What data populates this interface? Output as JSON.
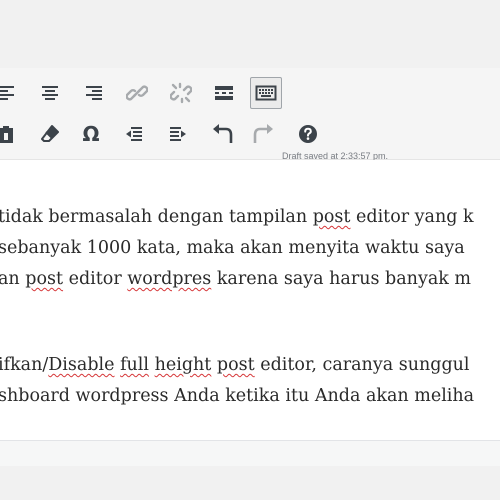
{
  "toolbar": {
    "row1": [
      {
        "name": "align-left-icon"
      },
      {
        "name": "align-center-icon"
      },
      {
        "name": "align-right-icon"
      },
      {
        "name": "insert-link-icon"
      },
      {
        "name": "remove-link-icon"
      },
      {
        "name": "read-more-icon"
      },
      {
        "name": "toolbar-toggle-icon",
        "active": true
      }
    ],
    "row2": [
      {
        "name": "paste-as-text-icon"
      },
      {
        "name": "clear-formatting-icon"
      },
      {
        "name": "special-character-icon",
        "glyph": "Ω"
      },
      {
        "name": "decrease-indent-icon"
      },
      {
        "name": "increase-indent-icon"
      },
      {
        "name": "undo-icon"
      },
      {
        "name": "redo-icon"
      },
      {
        "name": "keyboard-shortcuts-icon"
      }
    ]
  },
  "status": {
    "text": "Draft saved at 2:33:57 pm."
  },
  "content": {
    "lines": [
      [
        {
          "t": "tidak bermasalah dengan tampilan "
        },
        {
          "t": "post",
          "sp": true
        },
        {
          "t": " editor yang k"
        }
      ],
      [
        {
          "t": "sebanyak 1000 kata, maka akan menyita waktu saya"
        }
      ],
      [
        {
          "t": "an "
        },
        {
          "t": "post",
          "sp": true
        },
        {
          "t": " editor "
        },
        {
          "t": "wordpres",
          "sp": true
        },
        {
          "t": " karena saya harus banyak m"
        }
      ],
      [
        {
          "t": "ifkan/"
        },
        {
          "t": "Disable",
          "sp": true
        },
        {
          "t": " "
        },
        {
          "t": "full",
          "sp": true
        },
        {
          "t": " "
        },
        {
          "t": "height",
          "sp": true
        },
        {
          "t": " "
        },
        {
          "t": "post",
          "sp": true
        },
        {
          "t": " editor, caranya sunggul"
        }
      ],
      [
        {
          "t": "shboard wordpress Anda ketika itu Anda akan meliha"
        }
      ]
    ]
  },
  "colors": {
    "icon": "#3c434a",
    "icon_disabled": "#a7aaad",
    "spellcheck": "#d63638"
  }
}
